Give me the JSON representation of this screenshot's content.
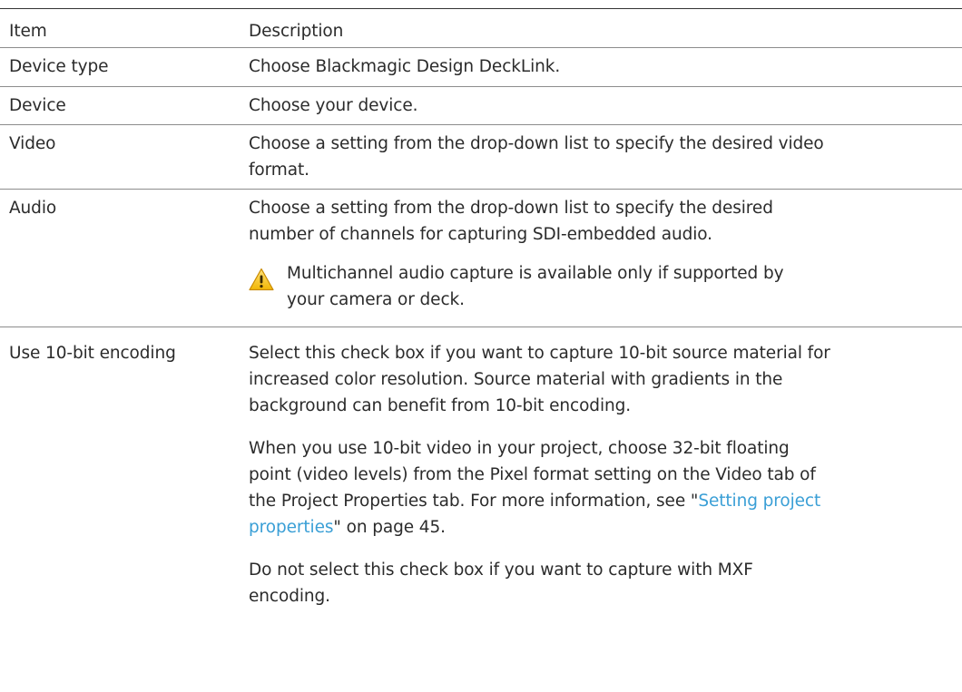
{
  "table": {
    "header": {
      "item": "Item",
      "description": "Description"
    },
    "rows": {
      "device_type": {
        "item": "Device type",
        "description": "Choose Blackmagic Design DeckLink."
      },
      "device": {
        "item": "Device",
        "description": "Choose your device."
      },
      "video": {
        "item": "Video",
        "description_l1": "Choose a setting from the drop-down list to specify the desired video",
        "description_l2": "format."
      },
      "audio": {
        "item": "Audio",
        "description_l1": "Choose a setting from the drop-down list to specify the desired",
        "description_l2": "number of channels for capturing SDI-embedded audio.",
        "note_icon": "warning-triangle-icon",
        "note_l1": "Multichannel audio capture is available only if supported by",
        "note_l2": "your camera or deck."
      },
      "encoding": {
        "item": "Use 10-bit encoding",
        "p1_l1": "Select this check box if you want to capture 10-bit source material for",
        "p1_l2": "increased color resolution. Source material with gradients in the",
        "p1_l3": "background can benefit from 10-bit encoding.",
        "p2_l1": "When you use 10-bit video in your project, choose 32-bit floating",
        "p2_l2": "point (video levels) from the Pixel format setting on the Video tab of",
        "p2_l3_pre": "the Project Properties tab. For more information, see \"",
        "p2_link_l1": "Setting project",
        "p2_link_l2": "properties",
        "p2_l4_post": "\" on page 45.",
        "p3_l1": "Do not select this check box if you want to capture with MXF",
        "p3_l2": "encoding."
      }
    }
  },
  "colors": {
    "link": "#3a9fd6",
    "warning": "#f2b705"
  }
}
